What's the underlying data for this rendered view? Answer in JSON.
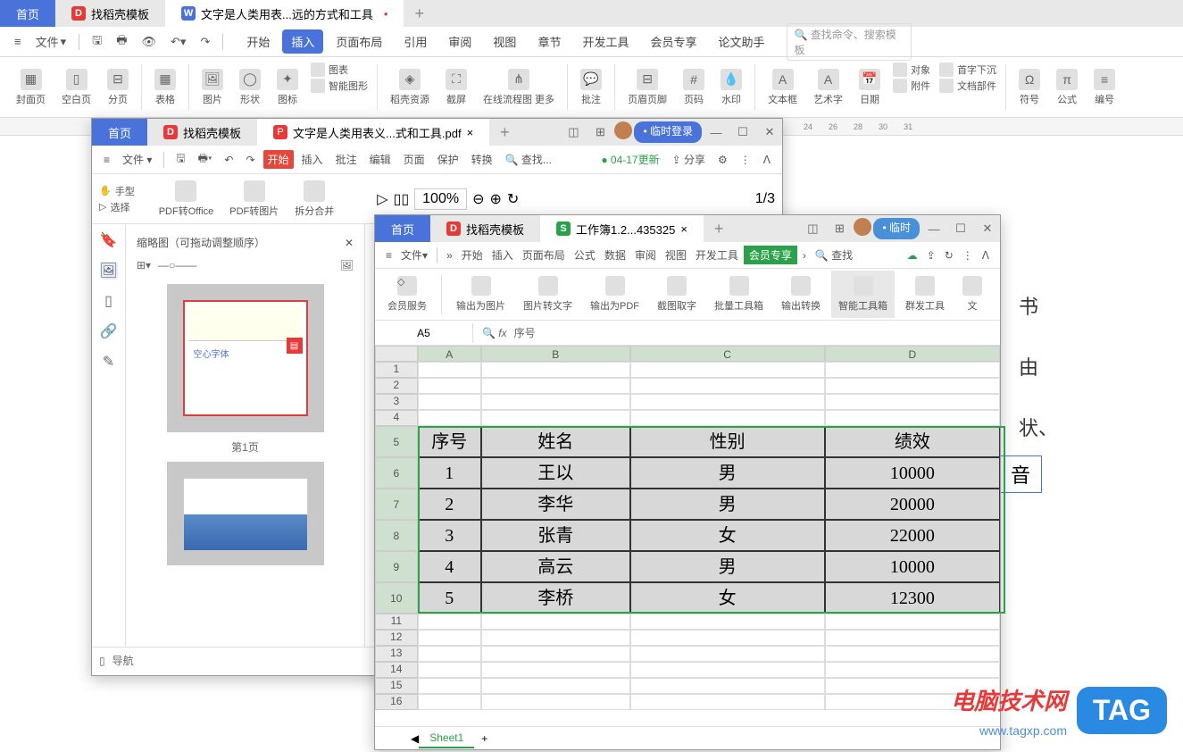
{
  "main": {
    "tabs": {
      "home": "首页",
      "template": "找稻壳模板",
      "doc": "文字是人类用表...远的方式和工具"
    },
    "file": "文件",
    "menus": {
      "start": "开始",
      "insert": "插入",
      "layout": "页面布局",
      "ref": "引用",
      "review": "审阅",
      "view": "视图",
      "chapter": "章节",
      "dev": "开发工具",
      "vip": "会员专享",
      "thesis": "论文助手"
    },
    "search": "查找命令、搜索模板",
    "ribbon": {
      "cover": "封面页",
      "blank": "空白页",
      "break": "分页",
      "table": "表格",
      "pic": "图片",
      "shape": "形状",
      "icon": "图标",
      "chart": "图表",
      "smart": "智能图形",
      "res": "稻壳资源",
      "crop": "截屏",
      "flow": "在线流程图 更多",
      "comment": "批注",
      "hf": "页眉页脚",
      "pageno": "页码",
      "wm": "水印",
      "textbox": "文本框",
      "wordart": "艺术字",
      "date": "日期",
      "obj": "对象",
      "attach": "附件",
      "parts": "文档部件",
      "sym": "符号",
      "formula": "公式",
      "num": "编号",
      "firstcap": "首字下沉"
    },
    "ruler": [
      "24",
      "26",
      "28",
      "30",
      "31"
    ]
  },
  "pdf": {
    "tabs": {
      "home": "首页",
      "template": "找稻壳模板",
      "doc": "文字是人类用表义...式和工具.pdf"
    },
    "login": "• 临时登录",
    "file": "文件",
    "menus": {
      "start": "开始",
      "insert": "插入",
      "annot": "批注",
      "edit": "编辑",
      "page": "页面",
      "protect": "保护",
      "convert": "转换"
    },
    "search": "查找...",
    "update": "04-17更新",
    "share": "分享",
    "tools": {
      "hand": "手型",
      "select": "选择",
      "office": "PDF转Office",
      "img": "PDF转图片",
      "split": "拆分合并"
    },
    "zoom": "100%",
    "page": "1/3",
    "thumb": {
      "title": "缩略图（可拖动调整顺序）",
      "p1": "第1页",
      "hollow": "空心字体"
    },
    "nav": "导航"
  },
  "ss": {
    "tabs": {
      "home": "首页",
      "template": "找稻壳模板",
      "doc": "工作簿1.2...435325"
    },
    "login": "• 临时",
    "file": "文件",
    "menus": {
      "start": "开始",
      "insert": "插入",
      "layout": "页面布局",
      "formula": "公式",
      "data": "数据",
      "review": "审阅",
      "view": "视图",
      "dev": "开发工具",
      "vip": "会员专享"
    },
    "search": "查找",
    "ribbon": {
      "vip": "会员服务",
      "outimg": "输出为图片",
      "img2txt": "图片转文字",
      "outpdf": "输出为PDF",
      "screencap": "截图取字",
      "batch": "批量工具箱",
      "outconv": "输出转换",
      "smart": "智能工具箱",
      "group": "群发工具",
      "doc": "文"
    },
    "cellref": "A5",
    "fx": "序号",
    "cols": [
      "A",
      "B",
      "C",
      "D"
    ],
    "headers": {
      "h1": "序号",
      "h2": "姓名",
      "h3": "性别",
      "h4": "绩效"
    },
    "rows": [
      {
        "n": "1",
        "name": "王以",
        "sex": "男",
        "val": "10000"
      },
      {
        "n": "2",
        "name": "李华",
        "sex": "男",
        "val": "20000"
      },
      {
        "n": "3",
        "name": "张青",
        "sex": "女",
        "val": "22000"
      },
      {
        "n": "4",
        "name": "高云",
        "sex": "男",
        "val": "10000"
      },
      {
        "n": "5",
        "name": "李桥",
        "sex": "女",
        "val": "12300"
      }
    ],
    "sheet": "Sheet1"
  },
  "doc": {
    "t1": "书",
    "t2": "由",
    "t3": "状、",
    "t4": "音"
  },
  "wm": {
    "a": "电脑技术网",
    "b": "www.tagxp.com",
    "tag": "TAG"
  }
}
